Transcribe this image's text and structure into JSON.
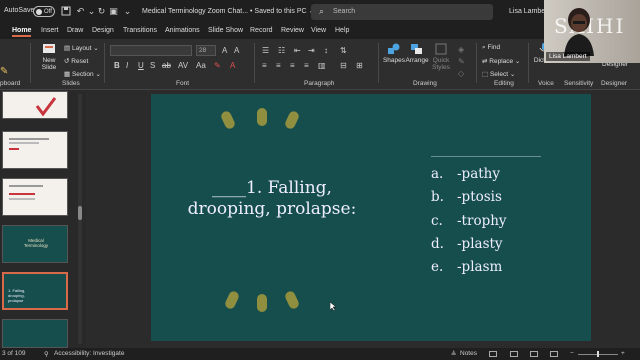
{
  "titlebar": {
    "autosave_label": "AutoSave",
    "autosave_state": "Off",
    "document_title": "Medical Terminology Zoom Chat... • Saved to this PC ⌄",
    "search_placeholder": "Search",
    "user_name": "Lisa Lambert"
  },
  "tabs": [
    "Home",
    "Insert",
    "Draw",
    "Design",
    "Transitions",
    "Animations",
    "Slide Show",
    "Record",
    "Review",
    "View",
    "Help"
  ],
  "ribbon": {
    "groups": {
      "clipboard": "pboard",
      "slides": "Slides",
      "font": "Font",
      "paragraph": "Paragraph",
      "drawing": "Drawing",
      "editing": "Editing",
      "voice": "Voice",
      "sensitivity": "Sensitivity",
      "designer": "Designer"
    },
    "new_slide": "New Slide",
    "layout": "Layout",
    "reset": "Reset",
    "section": "Section",
    "font_size": "28",
    "shapes": "Shapes",
    "arrange": "Arrange",
    "quick_styles": "Quick Styles",
    "find": "Find",
    "replace": "Replace",
    "select": "Select",
    "dictate": "Dictate",
    "designer_btn": "Designer"
  },
  "slide": {
    "question": "____1.    Falling, drooping, prolapse:",
    "answers": [
      {
        "letter": "a.",
        "text": "-pathy"
      },
      {
        "letter": "b.",
        "text": "-ptosis"
      },
      {
        "letter": "c.",
        "text": "-trophy"
      },
      {
        "letter": "d.",
        "text": "-plasty"
      },
      {
        "letter": "e.",
        "text": "-plasm"
      }
    ]
  },
  "thumbnails": {
    "selected_text": "1. Falling, drooping, prolapse",
    "medical_title": "Medical Terminology"
  },
  "statusbar": {
    "slide_count": "3 of 109",
    "accessibility": "Accessibility: Investigate",
    "notes": "Notes"
  },
  "webcam": {
    "name": "Lisa Lambert",
    "wall_text": "SAIHI"
  },
  "colors": {
    "slide_bg": "#164e4e",
    "accent": "#d86a4a",
    "dash": "#8f8f3f"
  }
}
